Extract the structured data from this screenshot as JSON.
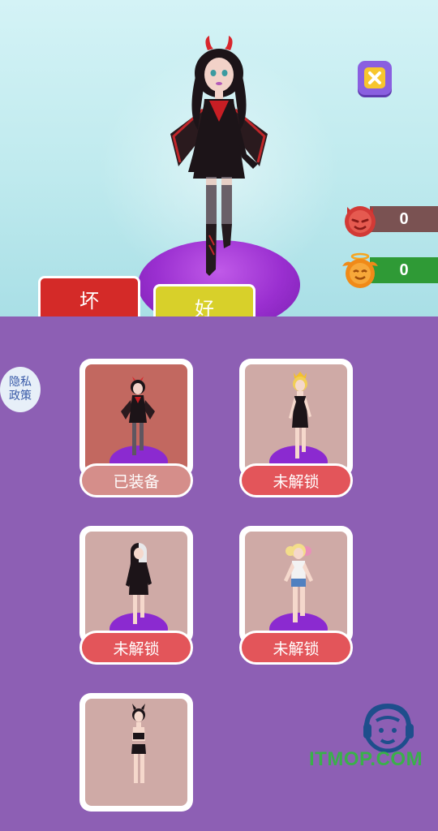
{
  "mode_tabs": {
    "bad": "坏",
    "good": "好"
  },
  "scores": {
    "bad_points": "0",
    "good_points": "0"
  },
  "privacy": {
    "line1": "隐私",
    "line2": "政策"
  },
  "colors": {
    "bad": "#d42a28",
    "good": "#d8d02a",
    "panel": "#8d5fb4",
    "locked": "#e3555a",
    "equipped": "#d58e8a"
  },
  "characters": [
    {
      "name": "devil",
      "status": "已装备"
    },
    {
      "name": "queen",
      "status": "未解锁"
    },
    {
      "name": "split-hair",
      "status": "未解锁"
    },
    {
      "name": "harley",
      "status": "未解锁"
    },
    {
      "name": "horned",
      "status": ""
    }
  ],
  "watermark": "ITMOP.COM"
}
